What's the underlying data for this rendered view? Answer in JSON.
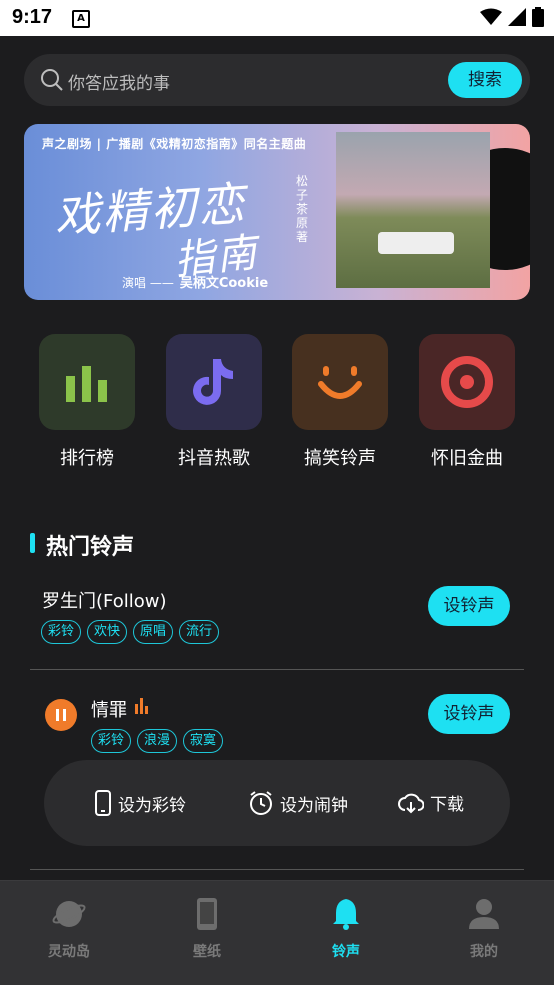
{
  "status": {
    "time": "9:17",
    "notif_icon": "A"
  },
  "search": {
    "placeholder": "你答应我的事",
    "button": "搜索"
  },
  "banner": {
    "top_line": "声之剧场 | 广播剧《戏精初恋指南》同名主题曲",
    "title_line1": "戏精初恋",
    "title_line2": "指南",
    "vertical_text": "松子茶 原著",
    "singer_label": "演唱 ——",
    "singer_name": "吴柄文Cookie"
  },
  "categories": [
    {
      "label": "排行榜",
      "icon": "bar-chart-icon",
      "color": "#8bc34a",
      "bg": "#2e3a2a"
    },
    {
      "label": "抖音热歌",
      "icon": "tiktok-icon",
      "color": "#7b6cf0",
      "bg": "#2f2d4a"
    },
    {
      "label": "搞笑铃声",
      "icon": "smile-icon",
      "color": "#f07b2a",
      "bg": "#47301f"
    },
    {
      "label": "怀旧金曲",
      "icon": "target-icon",
      "color": "#e64a4a",
      "bg": "#4a2626"
    }
  ],
  "section": {
    "title": "热门铃声"
  },
  "songs": [
    {
      "title": "罗生门(Follow)",
      "tags": [
        "彩铃",
        "欢快",
        "原唱",
        "流行"
      ],
      "button": "设铃声"
    },
    {
      "title": "情罪",
      "tags": [
        "彩铃",
        "浪漫",
        "寂寞"
      ],
      "button": "设铃声"
    }
  ],
  "actions": {
    "ring": "设为彩铃",
    "alarm": "设为闹钟",
    "download": "下载"
  },
  "nav": [
    {
      "label": "灵动岛",
      "icon": "planet-icon"
    },
    {
      "label": "壁纸",
      "icon": "phone-icon"
    },
    {
      "label": "铃声",
      "icon": "bell-icon"
    },
    {
      "label": "我的",
      "icon": "user-icon"
    }
  ],
  "colors": {
    "accent": "#1ee0f2",
    "orange": "#f07b2a",
    "background": "#1c1c1e"
  }
}
